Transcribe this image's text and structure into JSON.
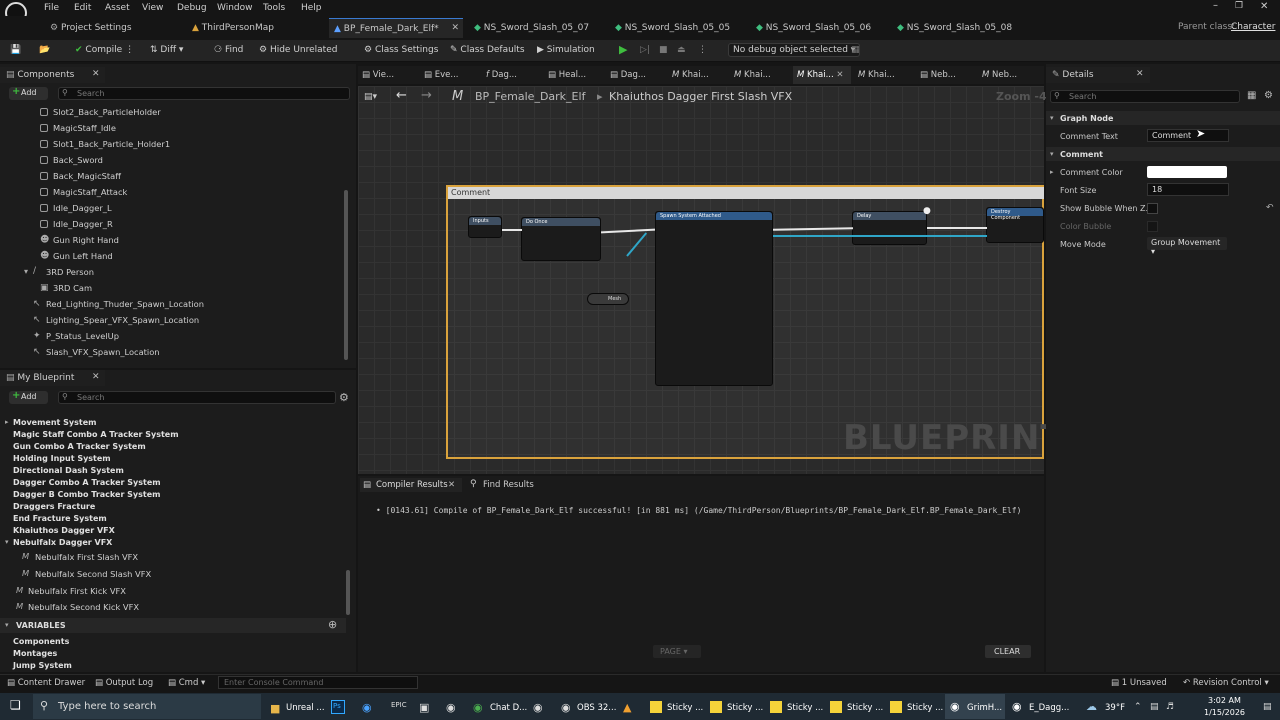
{
  "menu": {
    "items": [
      "File",
      "Edit",
      "Asset",
      "View",
      "Debug",
      "Window",
      "Tools",
      "Help"
    ]
  },
  "tabs": {
    "items": [
      "Project Settings",
      "ThirdPersonMap",
      "BP_Female_Dark_Elf*",
      "NS_Sword_Slash_05_07",
      "NS_Sword_Slash_05_05",
      "NS_Sword_Slash_05_06",
      "NS_Sword_Slash_05_08"
    ]
  },
  "parent_class": {
    "label": "Parent class:",
    "value": "Character"
  },
  "toolbar": {
    "compile": "Compile",
    "diff": "Diff",
    "find": "Find",
    "hide_unrelated": "Hide Unrelated",
    "class_settings": "Class Settings",
    "class_defaults": "Class Defaults",
    "simulation": "Simulation",
    "debug_object": "No debug object selected"
  },
  "components": {
    "title": "Components",
    "add": "Add",
    "search_placeholder": "Search",
    "items": [
      "Slot2_Back_ParticleHolder",
      "MagicStaff_Idle",
      "Slot1_Back_Particle_Holder1",
      "Back_Sword",
      "Back_MagicStaff",
      "MagicStaff_Attack",
      "Idle_Dagger_L",
      "Idle_Dagger_R",
      "Gun Right Hand",
      "Gun Left Hand",
      "3RD Person",
      "3RD Cam",
      "Red_Lighting_Thuder_Spawn_Location",
      "Lighting_Spear_VFX_Spawn_Location",
      "P_Status_LevelUp",
      "Slash_VFX_Spawn_Location"
    ]
  },
  "myblueprint": {
    "title": "My Blueprint",
    "add": "Add",
    "search_placeholder": "Search",
    "items": [
      "Movement System",
      "Magic Staff Combo A Tracker System",
      "Gun Combo A Tracker System",
      "Holding Input System",
      "Directional Dash System",
      "Dagger Combo A Tracker System",
      "Dagger B Combo Tracker System",
      "Draggers Fracture",
      "End Fracture System",
      "Khaiuthos Dagger VFX",
      "Nebulfalx Dagger VFX"
    ],
    "subitems": [
      "Nebulfalx First Slash VFX",
      "Nebulfalx Second Slash VFX"
    ],
    "macros": [
      "Nebulfalx First Kick VFX",
      "Nebulfalx Second Kick VFX"
    ],
    "variables_header": "VARIABLES",
    "variables": [
      "Components",
      "Montages",
      "Jump System"
    ]
  },
  "graph": {
    "subtabs": [
      "Vie...",
      "Eve...",
      "Dag...",
      "Heal...",
      "Dag...",
      "Khai...",
      "Khai...",
      "Khai...",
      "Khai...",
      "Neb...",
      "Neb..."
    ],
    "breadcrumb_bp": "BP_Female_Dark_Elf",
    "breadcrumb_fn": "Khaiuthos Dagger First Slash VFX",
    "zoom": "Zoom -4",
    "comment": "Comment",
    "watermark": "BLUEPRINT",
    "nodes": {
      "do_once": "Do Once",
      "spawn": "Spawn System Attached",
      "delay": "Delay",
      "destroy": "Destroy Component",
      "mesh": "Mesh",
      "inputs": "Inputs"
    }
  },
  "compiler": {
    "tab": "Compiler Results",
    "find_tab": "Find Results",
    "message": "[0143.61] Compile of BP_Female_Dark_Elf successful! [in 881 ms] (/Game/ThirdPerson/Blueprints/BP_Female_Dark_Elf.BP_Female_Dark_Elf)",
    "page": "PAGE",
    "clear": "CLEAR"
  },
  "details": {
    "title": "Details",
    "search_placeholder": "Search",
    "section_graph_node": "Graph Node",
    "comment_text_label": "Comment Text",
    "comment_text_value": "Comment",
    "section_comment": "Comment",
    "comment_color_label": "Comment Color",
    "font_size_label": "Font Size",
    "font_size_value": "18",
    "show_bubble_label": "Show Bubble When Z...",
    "color_bubble_label": "Color Bubble",
    "move_mode_label": "Move Mode",
    "move_mode_value": "Group Movement"
  },
  "statusbar": {
    "content_drawer": "Content Drawer",
    "output_log": "Output Log",
    "cmd": "Cmd",
    "console_placeholder": "Enter Console Command",
    "unsaved": "1 Unsaved",
    "revision": "Revision Control"
  },
  "taskbar": {
    "search_placeholder": "Type here to search",
    "apps": [
      "Unreal ...",
      "Chat D...",
      "OBS 32...",
      "Sticky ...",
      "Sticky ...",
      "Sticky ...",
      "Sticky ...",
      "Sticky ...",
      "GrimH...",
      "E_Dagg..."
    ],
    "weather": "39°F",
    "time": "3:02 AM",
    "date": "1/15/2026"
  },
  "colors": {
    "accent": "#3a7ad1",
    "selection_border": "#d9a23c",
    "compile_green": "#3fbe3f"
  }
}
